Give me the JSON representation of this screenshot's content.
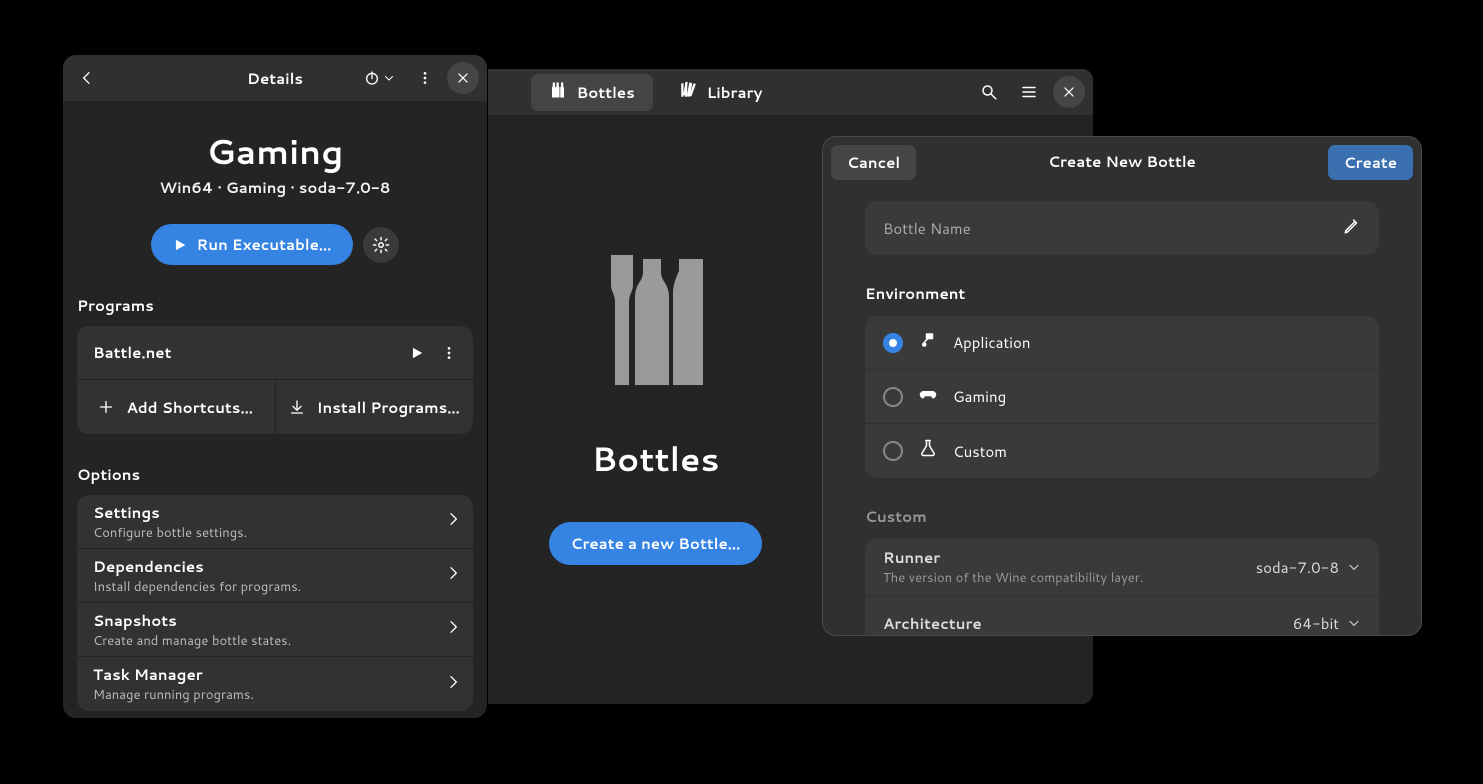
{
  "main": {
    "tabs": {
      "bottles": "Bottles",
      "library": "Library"
    },
    "hero_title": "Bottles",
    "cta": "Create a new Bottle…"
  },
  "details": {
    "header_title": "Details",
    "bottle_title": "Gaming",
    "meta": "Win64  ·  Gaming  ·  soda-7.0-8",
    "run_label": "Run Executable…",
    "programs_heading": "Programs",
    "program_name": "Battle.net",
    "add_shortcuts": "Add Shortcuts…",
    "install_programs": "Install Programs…",
    "options_heading": "Options",
    "options": [
      {
        "title": "Settings",
        "sub": "Configure bottle settings."
      },
      {
        "title": "Dependencies",
        "sub": "Install dependencies for programs."
      },
      {
        "title": "Snapshots",
        "sub": "Create and manage bottle states."
      },
      {
        "title": "Task Manager",
        "sub": "Manage running programs."
      }
    ]
  },
  "dialog": {
    "title": "Create New Bottle",
    "cancel": "Cancel",
    "create": "Create",
    "name_placeholder": "Bottle Name",
    "env_heading": "Environment",
    "env": {
      "application": "Application",
      "gaming": "Gaming",
      "custom": "Custom"
    },
    "custom_heading": "Custom",
    "runner": {
      "title": "Runner",
      "sub": "The version of the Wine compatibility layer.",
      "value": "soda-7.0-8"
    },
    "arch": {
      "title": "Architecture",
      "value": "64-bit"
    }
  }
}
